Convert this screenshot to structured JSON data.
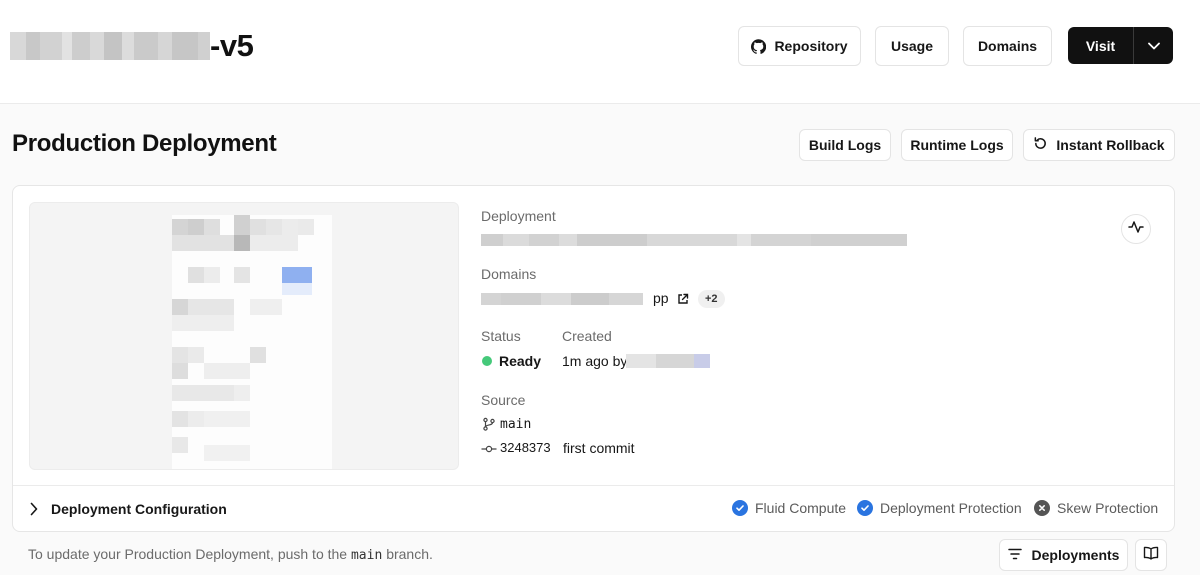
{
  "header": {
    "project_name_suffix": "-v5",
    "buttons": {
      "repository": "Repository",
      "usage": "Usage",
      "domains": "Domains",
      "visit": "Visit"
    }
  },
  "production": {
    "title": "Production Deployment",
    "buttons": {
      "build_logs": "Build Logs",
      "runtime_logs": "Runtime Logs",
      "instant_rollback": "Instant Rollback"
    }
  },
  "details": {
    "deployment_label": "Deployment",
    "domains_label": "Domains",
    "domain_suffix": "pp",
    "extra_domains": "+2",
    "status_label": "Status",
    "status_value": "Ready",
    "created_label": "Created",
    "created_value": "1m ago by",
    "source_label": "Source",
    "branch": "main",
    "commit_sha": "3248373",
    "commit_message": "first commit"
  },
  "configuration": {
    "label": "Deployment Configuration",
    "features": [
      {
        "label": "Fluid Compute",
        "enabled": true
      },
      {
        "label": "Deployment Protection",
        "enabled": true
      },
      {
        "label": "Skew Protection",
        "enabled": false
      }
    ]
  },
  "footer": {
    "note_prefix": "To update your Production Deployment, push to the",
    "note_branch": "main",
    "note_suffix": "branch.",
    "deployments_button": "Deployments"
  },
  "colors": {
    "accent_blue": "#2a74e0",
    "ready_green": "#45c97a",
    "dark_button": "#111111"
  }
}
